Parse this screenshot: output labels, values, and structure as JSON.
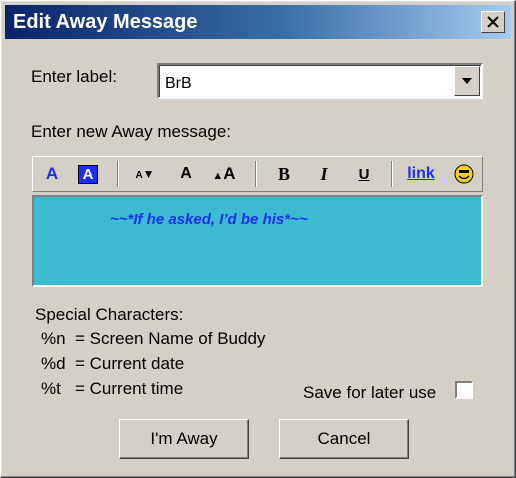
{
  "window": {
    "title": "Edit Away Message",
    "close_symbol": "✕"
  },
  "label_field": {
    "label": "Enter label:",
    "value": "BrB"
  },
  "message_section": {
    "label": "Enter new Away message:"
  },
  "toolbar": {
    "items": [
      {
        "name": "text-color-icon",
        "glyph": "A"
      },
      {
        "name": "background-color-icon",
        "glyph": "A"
      },
      {
        "name": "decrease-font-icon",
        "glyph": "A"
      },
      {
        "name": "normal-font-icon",
        "glyph": "A"
      },
      {
        "name": "increase-font-icon",
        "glyph": "A"
      },
      {
        "name": "bold-icon",
        "glyph": "B"
      },
      {
        "name": "italic-icon",
        "glyph": "I"
      },
      {
        "name": "underline-icon",
        "glyph": "U"
      },
      {
        "name": "link-icon",
        "glyph": "link"
      },
      {
        "name": "smiley-icon",
        "glyph": "☺"
      }
    ],
    "colors": {
      "blue": "#1a2ff0",
      "smiley_yellow": "#f5d020"
    }
  },
  "message": {
    "text": "~~*If he asked, I’d be his*~~",
    "background": "#3cbad0",
    "text_color": "#1a2ff0"
  },
  "special_chars": {
    "heading": "Special Characters:",
    "items": [
      {
        "code": "%n",
        "desc": "= Screen Name of Buddy"
      },
      {
        "code": "%d",
        "desc": "= Current date"
      },
      {
        "code": "%t",
        "desc": "= Current time"
      }
    ]
  },
  "save_option": {
    "label": "Save for later use",
    "checked": false
  },
  "buttons": {
    "away": "I'm Away",
    "cancel": "Cancel"
  }
}
